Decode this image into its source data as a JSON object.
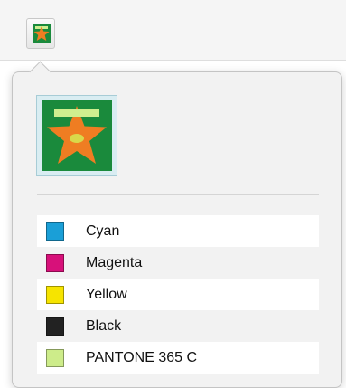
{
  "toolbar": {
    "thumbnail_icon": "artwork-thumbnail-icon"
  },
  "popover": {
    "preview_icon": "artwork-preview-star",
    "artwork_colors": {
      "background": "#1a8a3c",
      "star": "#ef7d22",
      "bar": "#cfee8f",
      "center": "#d9d84a"
    },
    "swatches": [
      {
        "label": "Cyan",
        "color": "#1a9fd7"
      },
      {
        "label": "Magenta",
        "color": "#d7117a"
      },
      {
        "label": "Yellow",
        "color": "#f6e400"
      },
      {
        "label": "Black",
        "color": "#222222"
      },
      {
        "label": "PANTONE 365 C",
        "color": "#cdec8a"
      }
    ]
  }
}
